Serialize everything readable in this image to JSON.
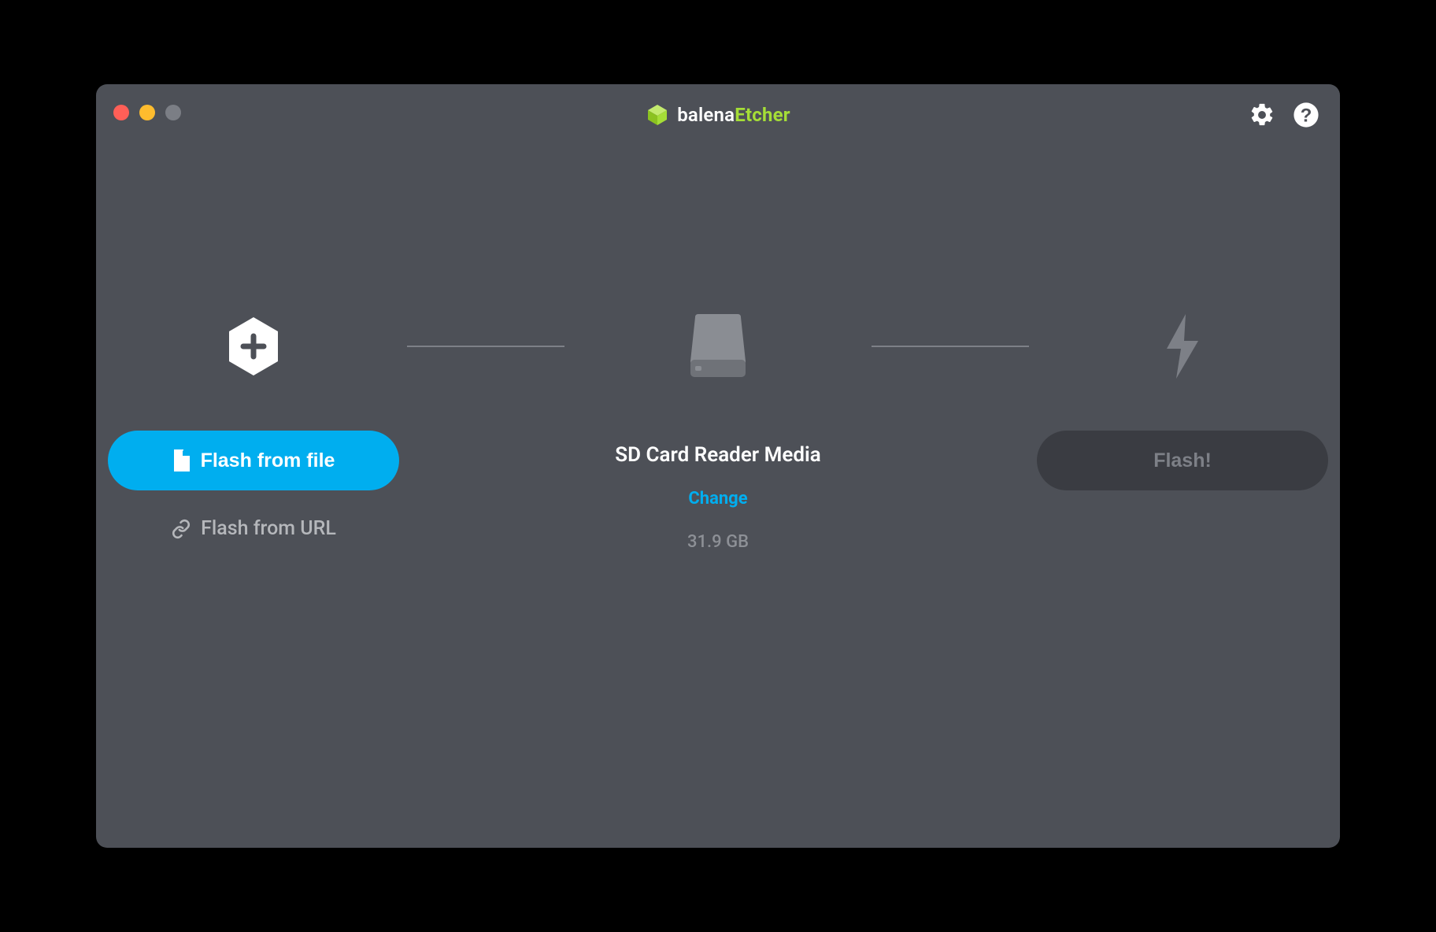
{
  "brand": {
    "prefix": "balena",
    "suffix": "Etcher"
  },
  "step1": {
    "flash_file_label": "Flash from file",
    "flash_url_label": "Flash from URL"
  },
  "step2": {
    "target_name": "SD Card Reader Media",
    "change_label": "Change",
    "size": "31.9 GB"
  },
  "step3": {
    "flash_label": "Flash!"
  },
  "colors": {
    "accent_green": "#a5de37",
    "accent_blue": "#00aeef",
    "bg": "#4d5057"
  }
}
